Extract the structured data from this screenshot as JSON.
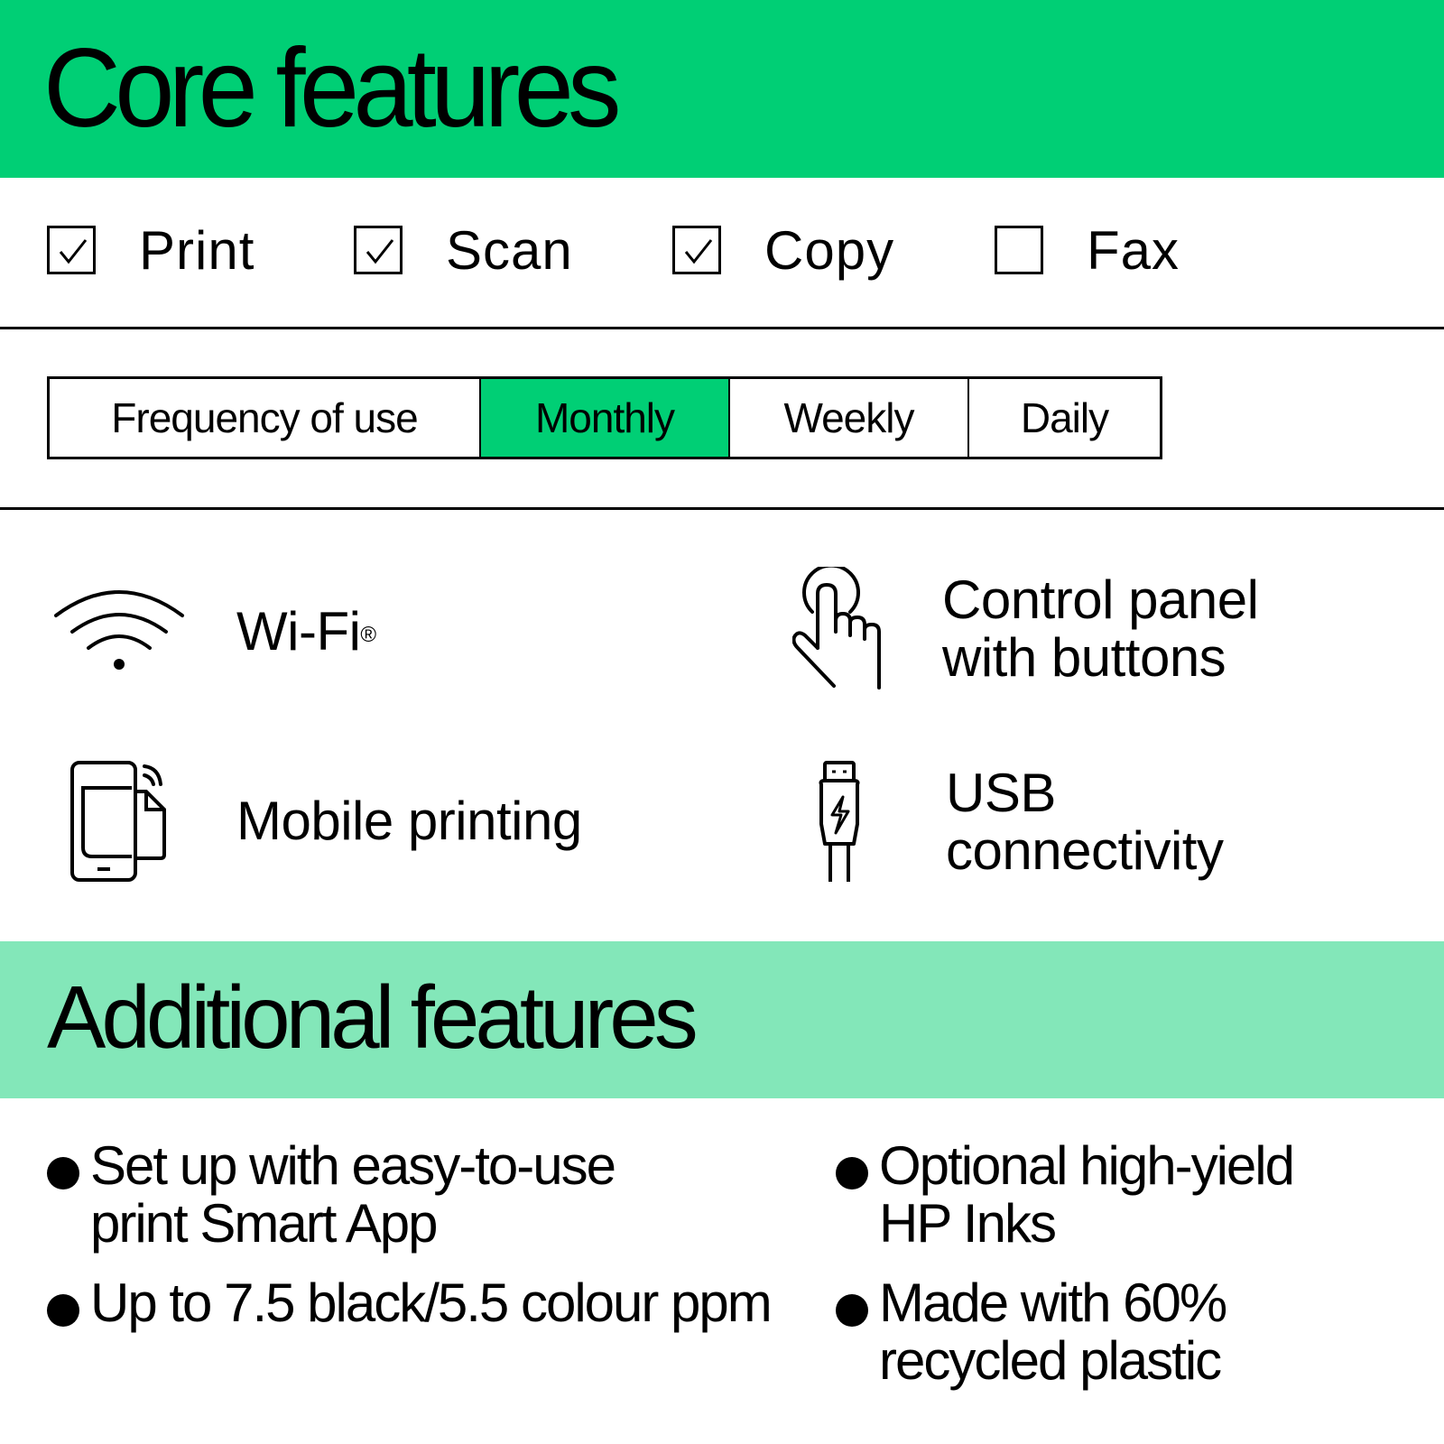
{
  "core": {
    "title": "Core features",
    "accent_color": "#00cf75",
    "functions": [
      {
        "label": "Print",
        "checked": true
      },
      {
        "label": "Scan",
        "checked": true
      },
      {
        "label": "Copy",
        "checked": true
      },
      {
        "label": "Fax",
        "checked": false
      }
    ],
    "frequency": {
      "label": "Frequency of use",
      "options": [
        "Monthly",
        "Weekly",
        "Daily"
      ],
      "selected": "Monthly"
    },
    "features": [
      {
        "icon": "wifi-icon",
        "label": "Wi-Fi",
        "mark": "®"
      },
      {
        "icon": "touch-hand-icon",
        "line1": "Control panel",
        "line2": "with buttons"
      },
      {
        "icon": "mobile-printing-icon",
        "label": "Mobile printing"
      },
      {
        "icon": "usb-icon",
        "line1": "USB",
        "line2": "connectivity"
      }
    ]
  },
  "additional": {
    "title": "Additional features",
    "accent_color": "#83e7b9",
    "bullets": [
      {
        "line1": "Set up with easy-to-use",
        "line2": "print Smart App"
      },
      {
        "line1": "Optional high-yield",
        "line2": "HP Inks"
      },
      {
        "line1": "Up to 7.5 black/5.5 colour ppm",
        "line2": ""
      },
      {
        "line1": "Made with 60%",
        "line2": "recycled plastic"
      }
    ]
  }
}
